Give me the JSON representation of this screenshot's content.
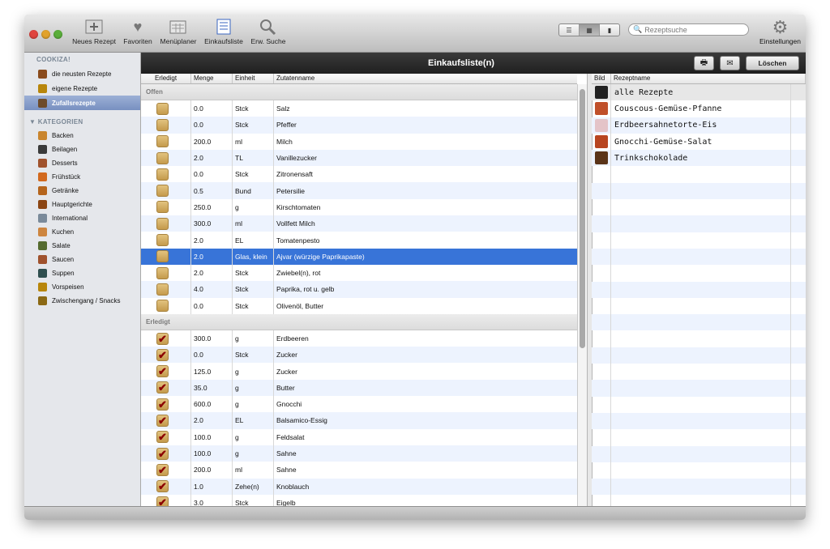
{
  "toolbar": {
    "buttons": [
      {
        "label": "Neues Rezept",
        "icon": "new-recipe-icon"
      },
      {
        "label": "Favoriten",
        "icon": "heart-icon"
      },
      {
        "label": "Menüplaner",
        "icon": "calendar-icon"
      },
      {
        "label": "Einkaufsliste",
        "icon": "checklist-icon"
      },
      {
        "label": "Erw. Suche",
        "icon": "magnifier-icon"
      }
    ],
    "search_placeholder": "Rezeptsuche",
    "settings_label": "Einstellungen"
  },
  "sidebar": {
    "header": "COOKIZA!",
    "items": [
      {
        "label": "die neusten Rezepte",
        "color": "#8a4b1c"
      },
      {
        "label": "eigene Rezepte",
        "color": "#b8860b"
      },
      {
        "label": "Zufallsrezepte",
        "color": "#6d4b2a"
      }
    ],
    "categories_header": "KATEGORIEN",
    "categories": [
      {
        "label": "Backen",
        "color": "#c9852e"
      },
      {
        "label": "Beilagen",
        "color": "#3a3a3a"
      },
      {
        "label": "Desserts",
        "color": "#a0522d"
      },
      {
        "label": "Frühstück",
        "color": "#d2691e"
      },
      {
        "label": "Getränke",
        "color": "#b5651d"
      },
      {
        "label": "Hauptgerichte",
        "color": "#8b4513"
      },
      {
        "label": "International",
        "color": "#7a8a9a"
      },
      {
        "label": "Kuchen",
        "color": "#cd853f"
      },
      {
        "label": "Salate",
        "color": "#556b2f"
      },
      {
        "label": "Saucen",
        "color": "#a0522d"
      },
      {
        "label": "Suppen",
        "color": "#2f4f4f"
      },
      {
        "label": "Vorspeisen",
        "color": "#b8860b"
      },
      {
        "label": "Zwischengang / Snacks",
        "color": "#8b6914"
      }
    ]
  },
  "main": {
    "title": "Einkaufsliste(n)",
    "delete_label": "Löschen",
    "columns": [
      "Erledigt",
      "Menge",
      "Einheit",
      "Zutatenname"
    ],
    "group_open": "Offen",
    "group_done": "Erledigt",
    "open_items": [
      {
        "menge": "0.0",
        "einheit": "Stck",
        "name": "Salz"
      },
      {
        "menge": "0.0",
        "einheit": "Stck",
        "name": "Pfeffer"
      },
      {
        "menge": "200.0",
        "einheit": "ml",
        "name": "Milch"
      },
      {
        "menge": "2.0",
        "einheit": "TL",
        "name": "Vanillezucker"
      },
      {
        "menge": "0.0",
        "einheit": "Stck",
        "name": "Zitronensaft"
      },
      {
        "menge": "0.5",
        "einheit": "Bund",
        "name": "Petersilie"
      },
      {
        "menge": "250.0",
        "einheit": "g",
        "name": "Kirschtomaten"
      },
      {
        "menge": "300.0",
        "einheit": "ml",
        "name": "Vollfett Milch"
      },
      {
        "menge": "2.0",
        "einheit": "EL",
        "name": "Tomatenpesto"
      },
      {
        "menge": "2.0",
        "einheit": "Glas, klein",
        "name": "Ajvar (würzige Paprikapaste)",
        "selected": true
      },
      {
        "menge": "2.0",
        "einheit": "Stck",
        "name": "Zwiebel(n), rot"
      },
      {
        "menge": "4.0",
        "einheit": "Stck",
        "name": "Paprika, rot u. gelb"
      },
      {
        "menge": "0.0",
        "einheit": "Stck",
        "name": "Olivenöl, Butter"
      }
    ],
    "done_items": [
      {
        "menge": "300.0",
        "einheit": "g",
        "name": "Erdbeeren"
      },
      {
        "menge": "0.0",
        "einheit": "Stck",
        "name": "Zucker"
      },
      {
        "menge": "125.0",
        "einheit": "g",
        "name": "Zucker"
      },
      {
        "menge": "35.0",
        "einheit": "g",
        "name": "Butter"
      },
      {
        "menge": "600.0",
        "einheit": "g",
        "name": "Gnocchi"
      },
      {
        "menge": "2.0",
        "einheit": "EL",
        "name": "Balsamico-Essig"
      },
      {
        "menge": "100.0",
        "einheit": "g",
        "name": "Feldsalat"
      },
      {
        "menge": "100.0",
        "einheit": "g",
        "name": "Sahne"
      },
      {
        "menge": "200.0",
        "einheit": "ml",
        "name": "Sahne"
      },
      {
        "menge": "1.0",
        "einheit": "Zehe(n)",
        "name": "Knoblauch"
      },
      {
        "menge": "3.0",
        "einheit": "Stck",
        "name": "Eigelb"
      }
    ]
  },
  "recipes": {
    "columns": [
      "Bild",
      "Rezeptname"
    ],
    "items": [
      {
        "label": "alle Rezepte",
        "color": "#222222"
      },
      {
        "label": "Couscous-Gemüse-Pfanne",
        "color": "#c0502a"
      },
      {
        "label": "Erdbeersahnetorte-Eis",
        "color": "#e4c4c8"
      },
      {
        "label": "Gnocchi-Gemüse-Salat",
        "color": "#b8451f"
      },
      {
        "label": "Trinkschokolade",
        "color": "#5a3418"
      }
    ]
  }
}
